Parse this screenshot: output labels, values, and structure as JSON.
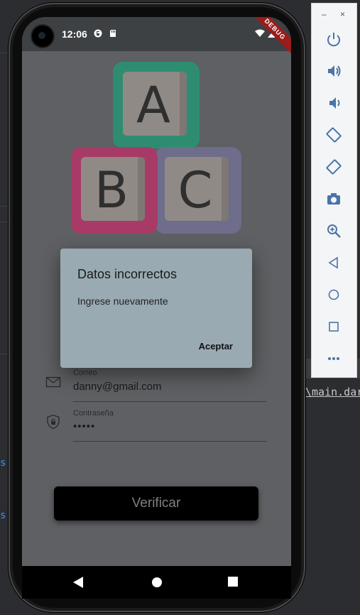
{
  "ide": {
    "code_snippet": "\\main.dar",
    "link1": "s",
    "link2": "s"
  },
  "status_bar": {
    "time": "12:06",
    "debug_banner": "DEBUG"
  },
  "logo_blocks": [
    {
      "letter": "A",
      "color": "#2e8d71"
    },
    {
      "letter": "B",
      "color": "#a83a67"
    },
    {
      "letter": "C",
      "color": "#6f6d8c"
    }
  ],
  "form": {
    "email_label": "Correo",
    "email_value": "danny@gmail.com",
    "password_label": "Contraseña",
    "password_value": "•••••",
    "verify_button": "Verificar"
  },
  "dialog": {
    "title": "Datos incorrectos",
    "message": "Ingrese nuevamente",
    "accept_button": "Aceptar"
  },
  "emulator_panel": {
    "minimize": "–",
    "close": "×",
    "buttons": [
      "power-icon",
      "volume-up-icon",
      "volume-down-icon",
      "rotate-left-icon",
      "rotate-right-icon",
      "camera-icon",
      "zoom-icon",
      "back-icon",
      "home-icon",
      "overview-icon",
      "more-icon"
    ]
  }
}
